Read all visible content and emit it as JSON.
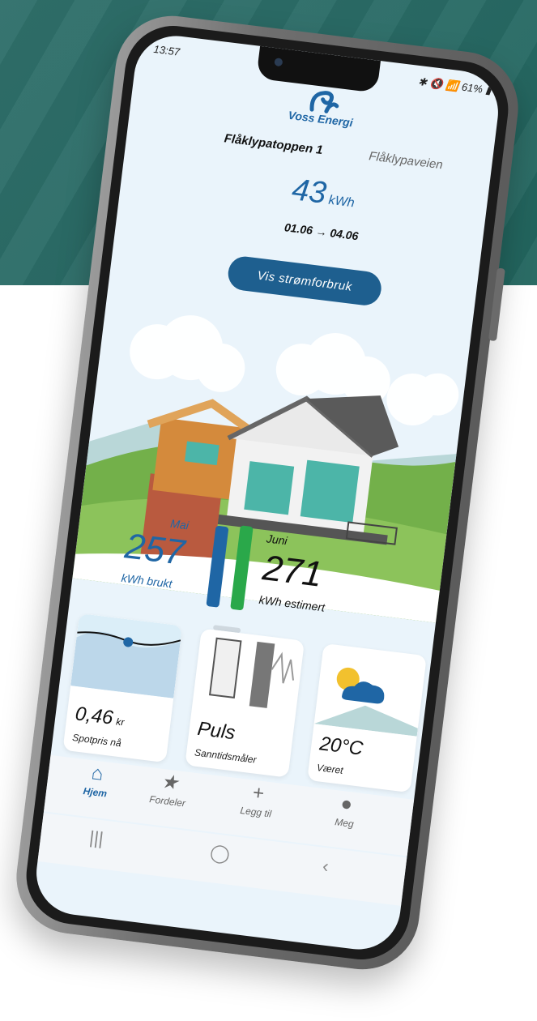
{
  "status": {
    "time": "13:57",
    "battery": "61%"
  },
  "brand": {
    "name": "Voss Energi"
  },
  "tabs": {
    "active": "Flåklypatoppen 1",
    "next": "Flåklypaveien"
  },
  "usage": {
    "value": "43",
    "unit": "kWh",
    "range": "01.06 → 04.06"
  },
  "actions": {
    "show_consumption": "Vis strømforbruk"
  },
  "compare": {
    "left_month": "Mai",
    "left_value": "257",
    "left_unit_text": "kWh brukt",
    "right_month": "Juni",
    "right_value": "271",
    "right_unit_text": "kWh estimert",
    "left_bar_fraction": 0.95,
    "right_bar_fraction": 1.0,
    "left_color": "#1f66a5",
    "right_color": "#2aa84a"
  },
  "cards": [
    {
      "value": "0,46",
      "unit": "kr",
      "label": "Spotpris nå"
    },
    {
      "value": "Puls",
      "unit": "",
      "label": "Sanntidsmåler"
    },
    {
      "value": "20°C",
      "unit": "",
      "label": "Været"
    }
  ],
  "nav": [
    {
      "label": "Hjem",
      "icon": "home-icon"
    },
    {
      "label": "Fordeler",
      "icon": "star-icon"
    },
    {
      "label": "Legg til",
      "icon": "plus-icon"
    },
    {
      "label": "Meg",
      "icon": "person-icon"
    }
  ],
  "colors": {
    "brand": "#1f66a5",
    "green": "#2aa84a",
    "bg": "#eaf4fb"
  }
}
